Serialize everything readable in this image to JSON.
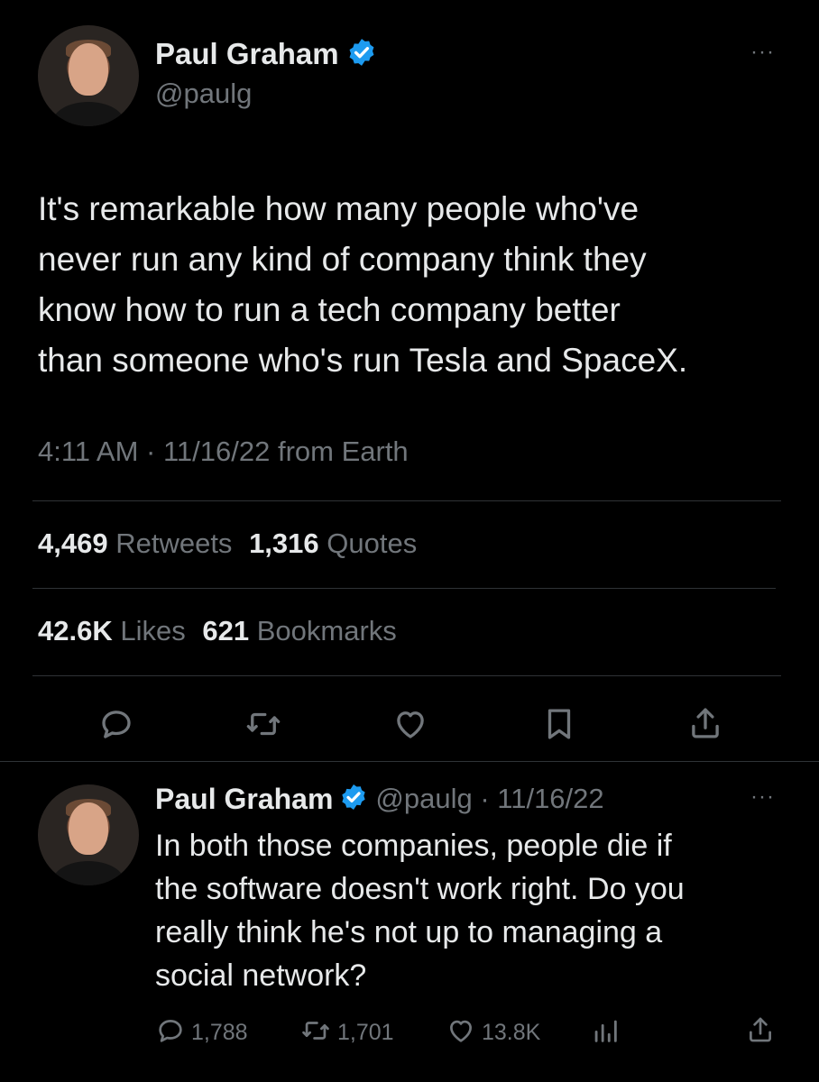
{
  "tweet": {
    "author_name": "Paul Graham",
    "handle": "@paulg",
    "text_lines": [
      "It's remarkable how many people who've",
      "never run any kind of company think they",
      "know how to run a tech company better",
      "than someone who's run Tesla and SpaceX."
    ],
    "timestamp": "4:11 AM · 11/16/22 from Earth",
    "retweets_count": "4,469",
    "retweets_label": "Retweets",
    "quotes_count": "1,316",
    "quotes_label": "Quotes",
    "likes_count": "42.6K",
    "likes_label": "Likes",
    "bookmarks_count": "621",
    "bookmarks_label": "Bookmarks",
    "more_label": "···",
    "actions": [
      "reply-icon",
      "retweet-icon",
      "like-icon",
      "bookmark-icon",
      "share-icon"
    ]
  },
  "reply": {
    "author_name": "Paul Graham",
    "handle_date": "@paulg · 11/16/22",
    "text_lines": [
      "In both those companies, people die if",
      "the software doesn't work right. Do you",
      "really think he's not up to managing a",
      "social network?"
    ],
    "reply_count": "1,788",
    "retweet_count": "1,701",
    "like_count": "13.8K",
    "more_label": "···"
  },
  "colors": {
    "background": "#000000",
    "text": "#e7e9ea",
    "muted": "#71767b",
    "verified": "#1d9bf0",
    "divider": "#2f3336"
  }
}
